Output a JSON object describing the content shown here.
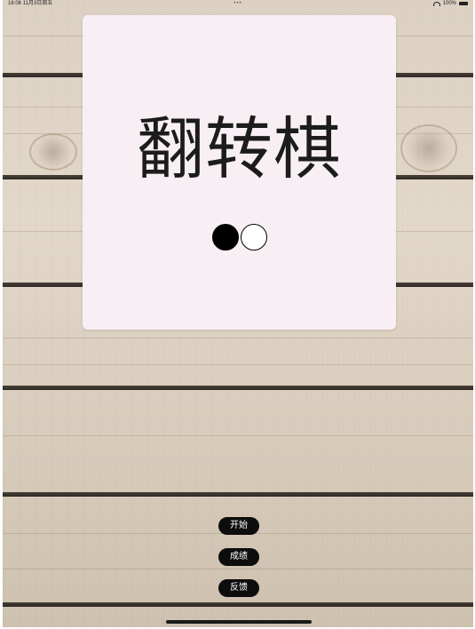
{
  "status_bar": {
    "time": "16:06",
    "date": "11月3日周五",
    "center_dots": "•••",
    "battery": "100%"
  },
  "game": {
    "title": "翻转棋",
    "piece_colors": {
      "black": "#000000",
      "white": "#ffffff"
    }
  },
  "menu": {
    "start_label": "开始",
    "scores_label": "成绩",
    "feedback_label": "反馈"
  },
  "colors": {
    "card_background": "#f8eff4",
    "button_background": "#0d0d0d",
    "button_text": "#ffffff"
  },
  "icons": {
    "wifi": "wifi-icon",
    "battery": "battery-icon"
  }
}
